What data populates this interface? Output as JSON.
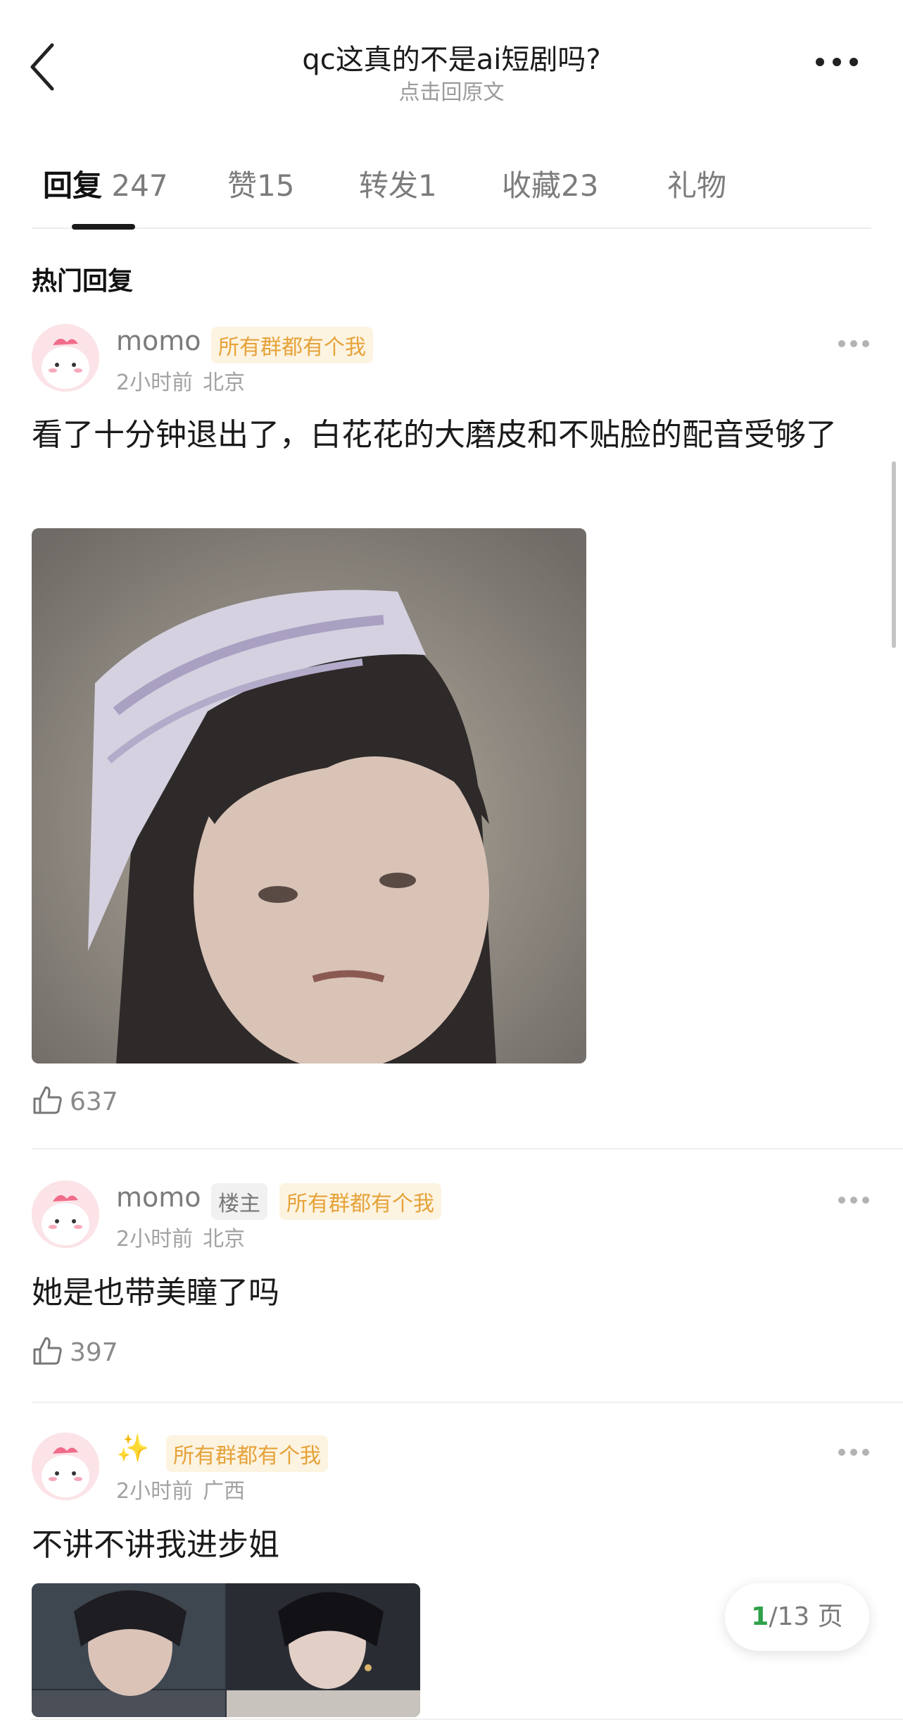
{
  "header": {
    "title": "qc这真的不是ai短剧吗?",
    "subtitle": "点击回原文"
  },
  "tabs": [
    {
      "label": "回复",
      "count": "247",
      "active": true
    },
    {
      "label": "赞",
      "count": "15"
    },
    {
      "label": "转发",
      "count": "1"
    },
    {
      "label": "收藏",
      "count": "23"
    },
    {
      "label": "礼物",
      "count": ""
    }
  ],
  "section_title": "热门回复",
  "comments": [
    {
      "username": "momo",
      "badges": [
        "所有群都有个我"
      ],
      "time": "2小时前",
      "location": "北京",
      "text": "看了十分钟退出了，白花花的大磨皮和不贴脸的配音受够了",
      "likes": "637"
    },
    {
      "username": "momo",
      "op_badge": "楼主",
      "badges": [
        "所有群都有个我"
      ],
      "time": "2小时前",
      "location": "北京",
      "text": "她是也带美瞳了吗",
      "likes": "397"
    },
    {
      "username": "✨",
      "badges": [
        "所有群都有个我"
      ],
      "time": "2小时前",
      "location": "广西",
      "text": "不讲不讲我进步姐"
    }
  ],
  "pager": {
    "current": "1",
    "total_text": "/13 页"
  },
  "colors": {
    "accent_green": "#2fa14a",
    "badge_text": "#e5a33a",
    "badge_bg": "#fdf3e1"
  }
}
